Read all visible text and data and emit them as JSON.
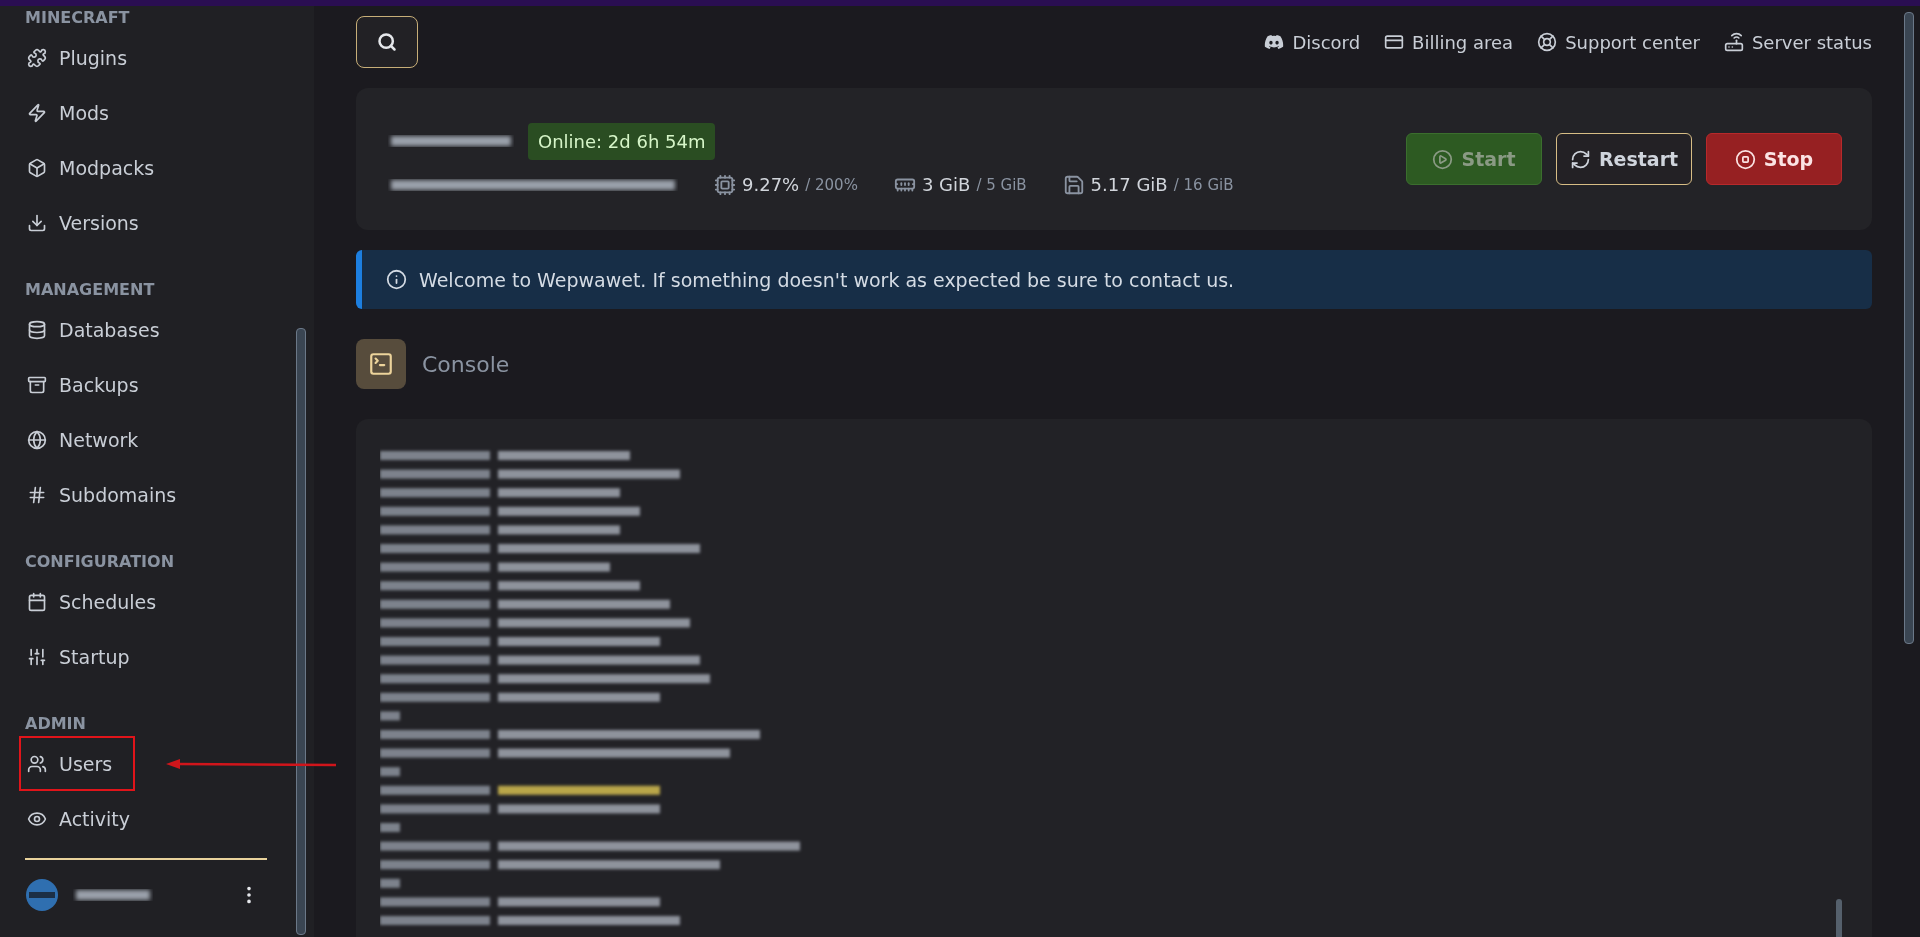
{
  "sidebar": {
    "sections": [
      {
        "title": "MINECRAFT",
        "items": [
          {
            "label": "Plugins",
            "highlighted": false
          },
          {
            "label": "Mods",
            "highlighted": false
          },
          {
            "label": "Modpacks",
            "highlighted": false
          },
          {
            "label": "Versions",
            "highlighted": false
          }
        ]
      },
      {
        "title": "MANAGEMENT",
        "items": [
          {
            "label": "Databases",
            "highlighted": false
          },
          {
            "label": "Backups",
            "highlighted": false
          },
          {
            "label": "Network",
            "highlighted": false
          },
          {
            "label": "Subdomains",
            "highlighted": false
          }
        ]
      },
      {
        "title": "CONFIGURATION",
        "items": [
          {
            "label": "Schedules",
            "highlighted": false
          },
          {
            "label": "Startup",
            "highlighted": false
          }
        ]
      },
      {
        "title": "ADMIN",
        "items": [
          {
            "label": "Users",
            "highlighted": true
          },
          {
            "label": "Activity",
            "highlighted": false
          }
        ]
      }
    ]
  },
  "header": {
    "links": [
      "Discord",
      "Billing area",
      "Support center",
      "Server status"
    ]
  },
  "server": {
    "status": "Online: 2d 6h 54m",
    "stats": [
      {
        "value": "9.27%",
        "limit": "/ 200%"
      },
      {
        "value": "3 GiB",
        "limit": "/ 5 GiB"
      },
      {
        "value": "5.17 GiB",
        "limit": "/ 16 GiB"
      }
    ],
    "buttons": [
      {
        "kind": "start",
        "label": "Start",
        "disabled": true
      },
      {
        "kind": "restart",
        "label": "Restart",
        "disabled": false
      },
      {
        "kind": "stop",
        "label": "Stop",
        "disabled": false
      }
    ]
  },
  "alert": "Welcome to Wepwawet. If something doesn't work as expected be sure to contact us.",
  "console": {
    "title": "Console"
  }
}
